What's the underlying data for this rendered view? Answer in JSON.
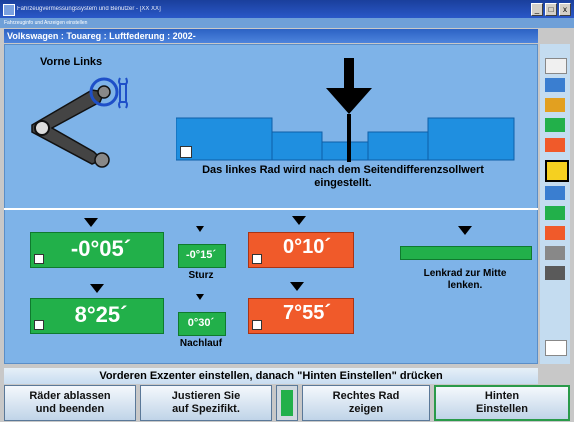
{
  "window": {
    "title": "Fahrzeugvermessungssystem und Benutzer - [XX XX]",
    "controls": [
      "_",
      "□",
      "x"
    ]
  },
  "subtitle": "Fahrzeuginfo und Anzeigen einstellen",
  "breadcrumb": "Volkswagen : Touareg : Luftfederung : 2002-",
  "top_panel": {
    "title": "Vorne Links",
    "message": "Das linkes Rad wird nach dem Seitendifferenzsollwert\neingestellt."
  },
  "measurements": {
    "sturz": {
      "value": "-0°05´",
      "spec": "-0°15´",
      "label": "Sturz"
    },
    "toe": {
      "value": "0°10´"
    },
    "nachlauf": {
      "value": "8°25´",
      "spec": "0°30´",
      "label": "Nachlauf"
    },
    "toe2": {
      "value": "7°55´"
    },
    "steering": {
      "label": "Lenkrad zur Mitte\nlenken."
    }
  },
  "status_bar": "Vorderen Exzenter einstellen, danach \"Hinten Einstellen\" drücken",
  "buttons": [
    {
      "label": "Räder ablassen\nund beenden"
    },
    {
      "label": "Justieren Sie\nauf Spezifikt."
    },
    {
      "label": "Rechtes Rad\nzeigen"
    },
    {
      "label": "Hinten\nEinstellen"
    }
  ],
  "toolbar_icons": [
    "adjust-icon",
    "camber-icon",
    "caster-icon",
    "toe-icon",
    "wheel-icon",
    "vehicle-icon",
    "front-icon",
    "rear-icon",
    "lift-icon",
    "steering-icon",
    "print-icon",
    "next-icon"
  ],
  "colors": {
    "green": "#22b04a",
    "red": "#f05a2a",
    "blue": "#1f8fe0"
  }
}
